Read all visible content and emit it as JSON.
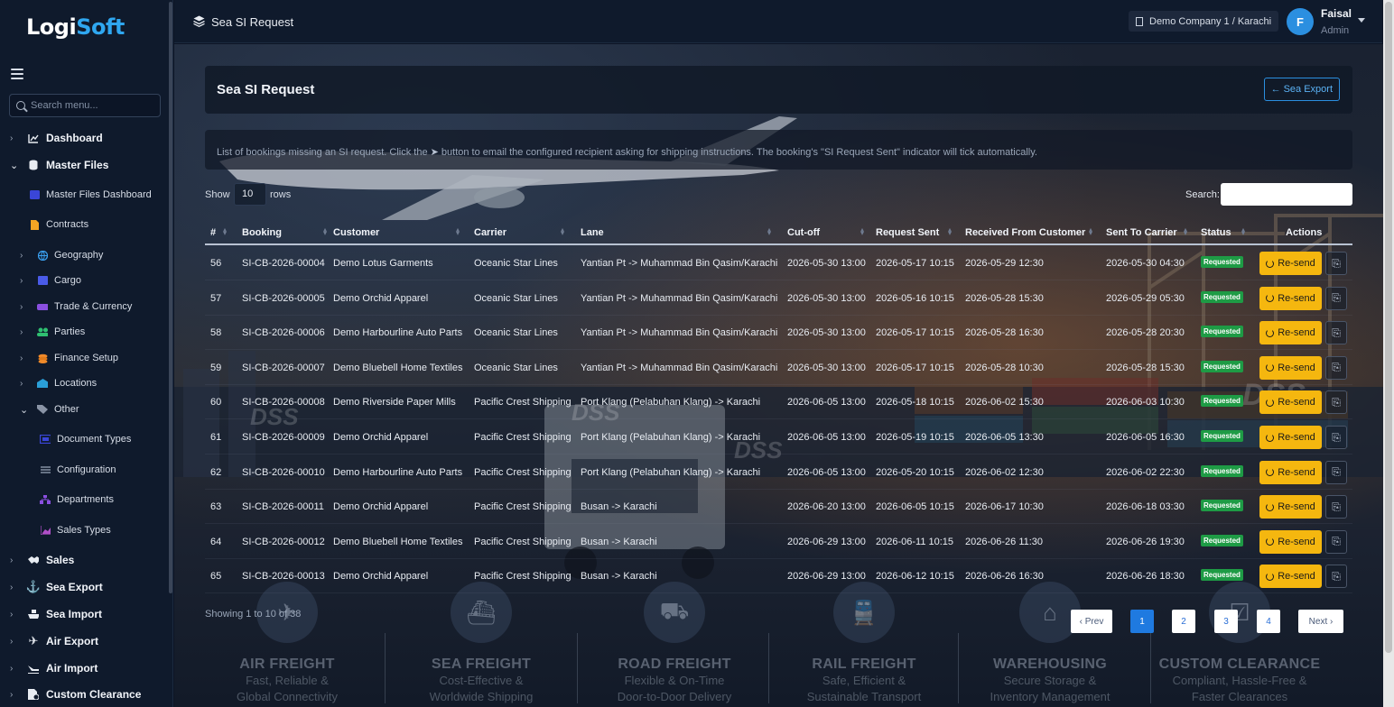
{
  "brand": {
    "logo_a": "Logi",
    "logo_b": "Soft"
  },
  "sidebar": {
    "search_placeholder": "Search menu...",
    "items": [
      {
        "label": "Dashboard",
        "icon": "chart-line-icon"
      },
      {
        "label": "Master Files",
        "icon": "database-icon"
      },
      {
        "label": "Master Files Dashboard",
        "icon": "dashboard-icon"
      },
      {
        "label": "Contracts",
        "icon": "file-icon"
      },
      {
        "label": "Geography",
        "icon": "globe-icon"
      },
      {
        "label": "Cargo",
        "icon": "box-icon"
      },
      {
        "label": "Trade & Currency",
        "icon": "exchange-icon"
      },
      {
        "label": "Parties",
        "icon": "users-icon"
      },
      {
        "label": "Finance Setup",
        "icon": "coins-icon"
      },
      {
        "label": "Locations",
        "icon": "warehouse-icon"
      },
      {
        "label": "Other",
        "icon": "tags-icon"
      },
      {
        "label": "Document Types",
        "icon": "doc-types-icon"
      },
      {
        "label": "Configuration",
        "icon": "sliders-icon"
      },
      {
        "label": "Departments",
        "icon": "sitemap-icon"
      },
      {
        "label": "Sales Types",
        "icon": "chart-area-icon"
      },
      {
        "label": "Sales",
        "icon": "handshake-icon"
      },
      {
        "label": "Sea Export",
        "icon": "anchor-icon"
      },
      {
        "label": "Sea Import",
        "icon": "ship-icon"
      },
      {
        "label": "Air Export",
        "icon": "plane-icon"
      },
      {
        "label": "Air Import",
        "icon": "plane-arrival-icon"
      },
      {
        "label": "Custom Clearance",
        "icon": "file-shield-icon"
      }
    ]
  },
  "header": {
    "title": "Sea SI Request",
    "company": "Demo Company 1 / Karachi",
    "user_initial": "F",
    "user_name": "Faisal",
    "user_role": "Admin"
  },
  "page": {
    "title": "Sea SI Request",
    "back_label": "Sea Export",
    "info_a": "List of bookings missing an SI request. Click the",
    "info_b": "button to email the configured recipient asking for shipping instructions. The booking's \"SI Request Sent\" indicator will tick automatically.",
    "show_label": "Show",
    "rows_value": "10",
    "rows_label": "rows",
    "search_label": "Search:"
  },
  "table": {
    "columns": [
      "#",
      "Booking",
      "Customer",
      "Carrier",
      "Lane",
      "Cut-off",
      "Request Sent",
      "Received From Customer",
      "Sent To Carrier",
      "Status",
      "Actions"
    ],
    "rows": [
      {
        "n": "56",
        "booking": "SI-CB-2026-00004",
        "customer": "Demo Lotus Garments",
        "carrier": "Oceanic Star Lines",
        "lane": "Yantian Pt -> Muhammad Bin Qasim/Karachi",
        "cutoff": "2026-05-30 13:00",
        "req": "2026-05-17 10:15",
        "recv": "2026-05-29 12:30",
        "sent": "2026-05-30 04:30",
        "status": "Requested",
        "action": "Re-send"
      },
      {
        "n": "57",
        "booking": "SI-CB-2026-00005",
        "customer": "Demo Orchid Apparel",
        "carrier": "Oceanic Star Lines",
        "lane": "Yantian Pt -> Muhammad Bin Qasim/Karachi",
        "cutoff": "2026-05-30 13:00",
        "req": "2026-05-16 10:15",
        "recv": "2026-05-28 15:30",
        "sent": "2026-05-29 05:30",
        "status": "Requested",
        "action": "Re-send"
      },
      {
        "n": "58",
        "booking": "SI-CB-2026-00006",
        "customer": "Demo Harbourline Auto Parts",
        "carrier": "Oceanic Star Lines",
        "lane": "Yantian Pt -> Muhammad Bin Qasim/Karachi",
        "cutoff": "2026-05-30 13:00",
        "req": "2026-05-17 10:15",
        "recv": "2026-05-28 16:30",
        "sent": "2026-05-28 20:30",
        "status": "Requested",
        "action": "Re-send"
      },
      {
        "n": "59",
        "booking": "SI-CB-2026-00007",
        "customer": "Demo Bluebell Home Textiles",
        "carrier": "Oceanic Star Lines",
        "lane": "Yantian Pt -> Muhammad Bin Qasim/Karachi",
        "cutoff": "2026-05-30 13:00",
        "req": "2026-05-17 10:15",
        "recv": "2026-05-28 10:30",
        "sent": "2026-05-28 15:30",
        "status": "Requested",
        "action": "Re-send"
      },
      {
        "n": "60",
        "booking": "SI-CB-2026-00008",
        "customer": "Demo Riverside Paper Mills",
        "carrier": "Pacific Crest Shipping",
        "lane": "Port Klang (Pelabuhan Klang) -> Karachi",
        "cutoff": "2026-06-05 13:00",
        "req": "2026-05-18 10:15",
        "recv": "2026-06-02 15:30",
        "sent": "2026-06-03 10:30",
        "status": "Requested",
        "action": "Re-send"
      },
      {
        "n": "61",
        "booking": "SI-CB-2026-00009",
        "customer": "Demo Orchid Apparel",
        "carrier": "Pacific Crest Shipping",
        "lane": "Port Klang (Pelabuhan Klang) -> Karachi",
        "cutoff": "2026-06-05 13:00",
        "req": "2026-05-19 10:15",
        "recv": "2026-06-05 13:30",
        "sent": "2026-06-05 16:30",
        "status": "Requested",
        "action": "Re-send"
      },
      {
        "n": "62",
        "booking": "SI-CB-2026-00010",
        "customer": "Demo Harbourline Auto Parts",
        "carrier": "Pacific Crest Shipping",
        "lane": "Port Klang (Pelabuhan Klang) -> Karachi",
        "cutoff": "2026-06-05 13:00",
        "req": "2026-05-20 10:15",
        "recv": "2026-06-02 12:30",
        "sent": "2026-06-02 22:30",
        "status": "Requested",
        "action": "Re-send"
      },
      {
        "n": "63",
        "booking": "SI-CB-2026-00011",
        "customer": "Demo Orchid Apparel",
        "carrier": "Pacific Crest Shipping",
        "lane": "Busan -> Karachi",
        "cutoff": "2026-06-20 13:00",
        "req": "2026-06-05 10:15",
        "recv": "2026-06-17 10:30",
        "sent": "2026-06-18 03:30",
        "status": "Requested",
        "action": "Re-send"
      },
      {
        "n": "64",
        "booking": "SI-CB-2026-00012",
        "customer": "Demo Bluebell Home Textiles",
        "carrier": "Pacific Crest Shipping",
        "lane": "Busan -> Karachi",
        "cutoff": "2026-06-29 13:00",
        "req": "2026-06-11 10:15",
        "recv": "2026-06-26 11:30",
        "sent": "2026-06-26 19:30",
        "status": "Requested",
        "action": "Re-send"
      },
      {
        "n": "65",
        "booking": "SI-CB-2026-00013",
        "customer": "Demo Orchid Apparel",
        "carrier": "Pacific Crest Shipping",
        "lane": "Busan -> Karachi",
        "cutoff": "2026-06-29 13:00",
        "req": "2026-06-12 10:15",
        "recv": "2026-06-26 16:30",
        "sent": "2026-06-26 18:30",
        "status": "Requested",
        "action": "Re-send"
      }
    ]
  },
  "footer": {
    "showing": "Showing 1 to 10 of 38",
    "prev": "‹ Prev",
    "next": "Next ›",
    "pages": [
      "1",
      "2",
      "3",
      "4"
    ]
  },
  "watermark": "DSS",
  "services": [
    {
      "name": "AIR FREIGHT",
      "l1": "Fast, Reliable &",
      "l2": "Global Connectivity",
      "icon": "plane-icon"
    },
    {
      "name": "SEA FREIGHT",
      "l1": "Cost-Effective &",
      "l2": "Worldwide Shipping",
      "icon": "ship-icon"
    },
    {
      "name": "ROAD FREIGHT",
      "l1": "Flexible & On-Time",
      "l2": "Door-to-Door Delivery",
      "icon": "truck-icon"
    },
    {
      "name": "RAIL FREIGHT",
      "l1": "Safe, Efficient &",
      "l2": "Sustainable Transport",
      "icon": "train-icon"
    },
    {
      "name": "WAREHOUSING",
      "l1": "Secure Storage &",
      "l2": "Inventory Management",
      "icon": "warehouse-icon"
    },
    {
      "name": "CUSTOM CLEARANCE",
      "l1": "Compliant, Hassle-Free &",
      "l2": "Faster Clearances",
      "icon": "clipboard-check-icon"
    }
  ],
  "colors": {
    "accent": "#2b8fe0",
    "status_green": "#1e9b45",
    "action_yellow": "#f5b70f",
    "sidebar_bg": "#0f1a2c"
  }
}
